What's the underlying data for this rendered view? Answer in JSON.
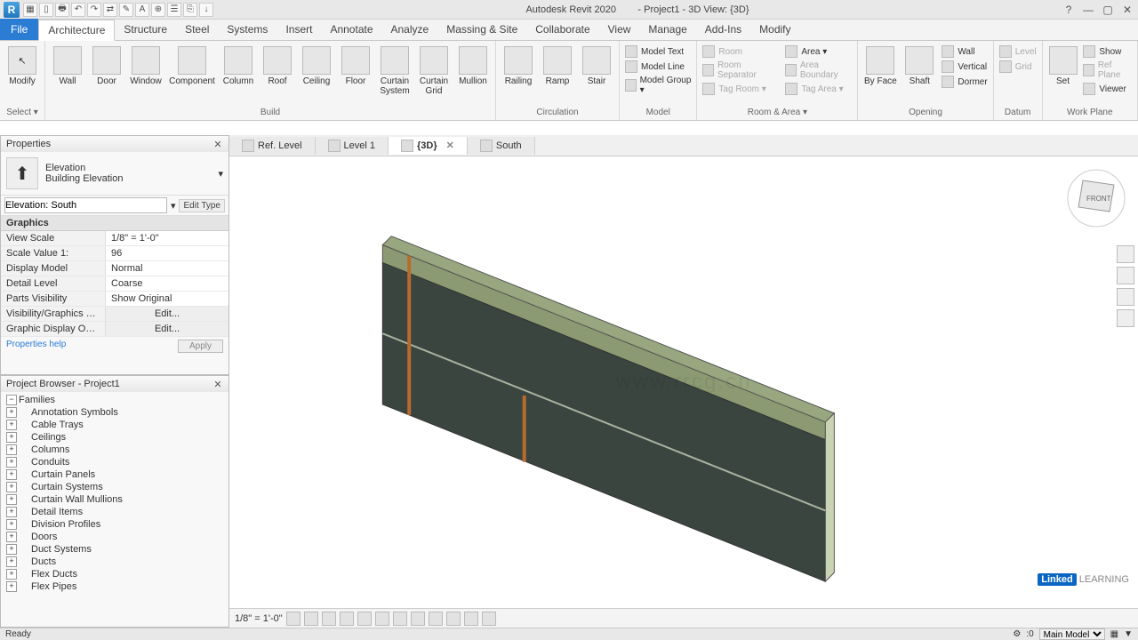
{
  "app": {
    "title_left": "Autodesk Revit 2020",
    "title_right": "- Project1 - 3D View: {3D}",
    "logo": "R"
  },
  "qat": [
    "▦",
    "▯",
    "🖶",
    "↶",
    "↷",
    "⇄",
    "✎",
    "A",
    "⊕",
    "☰",
    "⎘",
    "↓"
  ],
  "window_controls": {
    "help": "?",
    "min": "—",
    "max": "▢",
    "close": "✕"
  },
  "menu": {
    "file": "File",
    "tabs": [
      "Architecture",
      "Structure",
      "Steel",
      "Systems",
      "Insert",
      "Annotate",
      "Analyze",
      "Massing & Site",
      "Collaborate",
      "View",
      "Manage",
      "Add-Ins",
      "Modify"
    ],
    "active": "Architecture"
  },
  "ribbon": {
    "select": {
      "modify": "Modify",
      "select": "Select ▾"
    },
    "build": {
      "name": "Build",
      "tools": [
        "Wall",
        "Door",
        "Window",
        "Component",
        "Column",
        "Roof",
        "Ceiling",
        "Floor",
        "Curtain System",
        "Curtain Grid",
        "Mullion"
      ]
    },
    "circulation": {
      "name": "Circulation",
      "tools": [
        "Railing",
        "Ramp",
        "Stair"
      ]
    },
    "model": {
      "name": "Model",
      "items": [
        "Model  Text",
        "Model  Line",
        "Model  Group ▾"
      ]
    },
    "room_area": {
      "name": "Room & Area ▾",
      "left": [
        "Room",
        "Room  Separator",
        "Tag  Room ▾"
      ],
      "right": [
        "Area ▾",
        "Area  Boundary",
        "Tag  Area ▾"
      ]
    },
    "opening": {
      "name": "Opening",
      "tools": [
        "By Face",
        "Shaft"
      ],
      "side": [
        "Wall",
        "Vertical",
        "Dormer"
      ]
    },
    "datum": {
      "name": "Datum",
      "items": [
        "Level",
        "Grid"
      ]
    },
    "workplane": {
      "name": "Work Plane",
      "tools": [
        "Set"
      ],
      "side": [
        "Show",
        "Ref  Plane",
        "Viewer"
      ]
    }
  },
  "properties": {
    "title": "Properties",
    "type_name": "Elevation",
    "type_sub": "Building Elevation",
    "selector": "Elevation: South",
    "edit_type": "Edit Type",
    "category": "Graphics",
    "rows": [
      {
        "k": "View Scale",
        "v": "1/8\" = 1'-0\""
      },
      {
        "k": "Scale Value    1:",
        "v": "96"
      },
      {
        "k": "Display Model",
        "v": "Normal"
      },
      {
        "k": "Detail Level",
        "v": "Coarse"
      },
      {
        "k": "Parts Visibility",
        "v": "Show Original"
      },
      {
        "k": "Visibility/Graphics Ov...",
        "v": "Edit..."
      },
      {
        "k": "Graphic Display Optio...",
        "v": "Edit..."
      }
    ],
    "help": "Properties help",
    "apply": "Apply"
  },
  "browser": {
    "title": "Project Browser - Project1",
    "root": "Families",
    "items": [
      "Annotation Symbols",
      "Cable Trays",
      "Ceilings",
      "Columns",
      "Conduits",
      "Curtain Panels",
      "Curtain Systems",
      "Curtain Wall Mullions",
      "Detail Items",
      "Division Profiles",
      "Doors",
      "Duct Systems",
      "Ducts",
      "Flex Ducts",
      "Flex Pipes"
    ]
  },
  "views": {
    "tabs": [
      {
        "label": "Ref. Level",
        "active": false
      },
      {
        "label": "Level 1",
        "active": false
      },
      {
        "label": "{3D}",
        "active": true
      },
      {
        "label": "South",
        "active": false
      }
    ]
  },
  "view_status": {
    "scale": "1/8\" = 1'-0\""
  },
  "statusbar": {
    "ready": "Ready",
    "mult": ":0",
    "model": "Main Model"
  },
  "navcube": {
    "front": "FRONT"
  },
  "branding": {
    "linkedin": "Linked",
    "learning": "LEARNING",
    "watermark": "www.rrcg.cn"
  }
}
